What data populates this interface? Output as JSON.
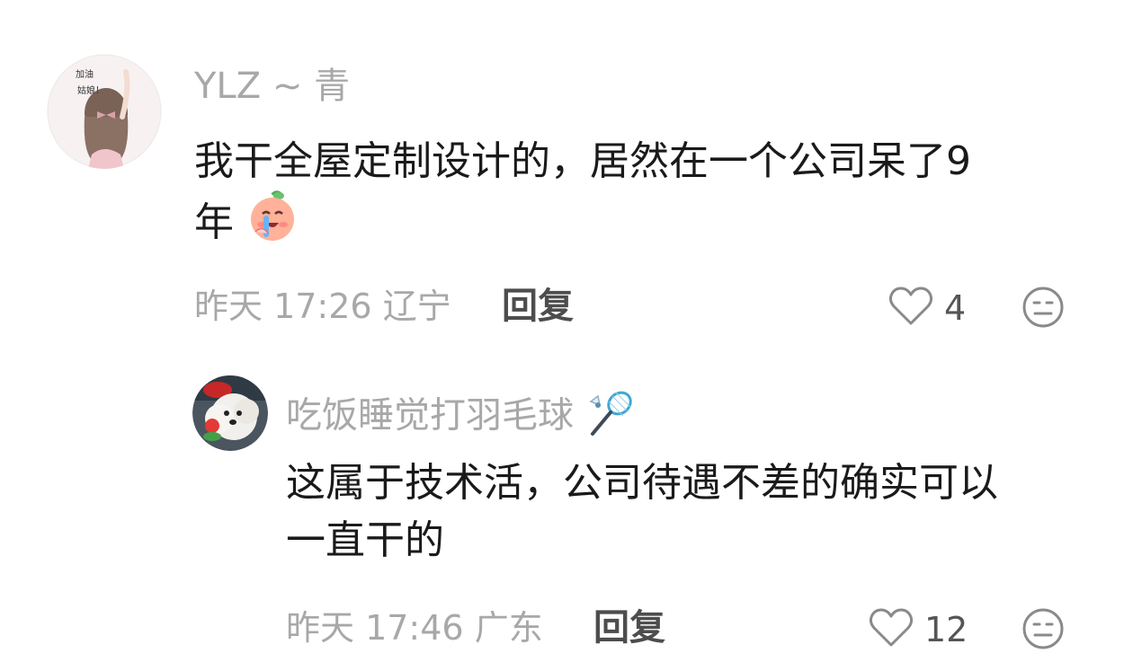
{
  "comments": [
    {
      "username": "YLZ ~ 青",
      "avatar_text": [
        "加油",
        "姑娘！"
      ],
      "content_line1": "我干全屋定制设计的，居然在一个公司呆了9",
      "content_line2": "年",
      "emoji": "crying-face-emoji",
      "time": "昨天 17:26",
      "location": "辽宁",
      "reply_label": "回复",
      "likes": "4"
    },
    {
      "username": "吃饭睡觉打羽毛球",
      "username_emoji": "badminton-icon",
      "content_line1": "这属于技术活，公司待遇不差的确实可以",
      "content_line2": "一直干的",
      "time": "昨天 17:46",
      "location": "广东",
      "reply_label": "回复",
      "likes": "12"
    }
  ],
  "colors": {
    "meta": "#a8a8a8",
    "text": "#1a1a1a",
    "reply": "#4d4d4d",
    "icon": "#8a8a8a"
  }
}
